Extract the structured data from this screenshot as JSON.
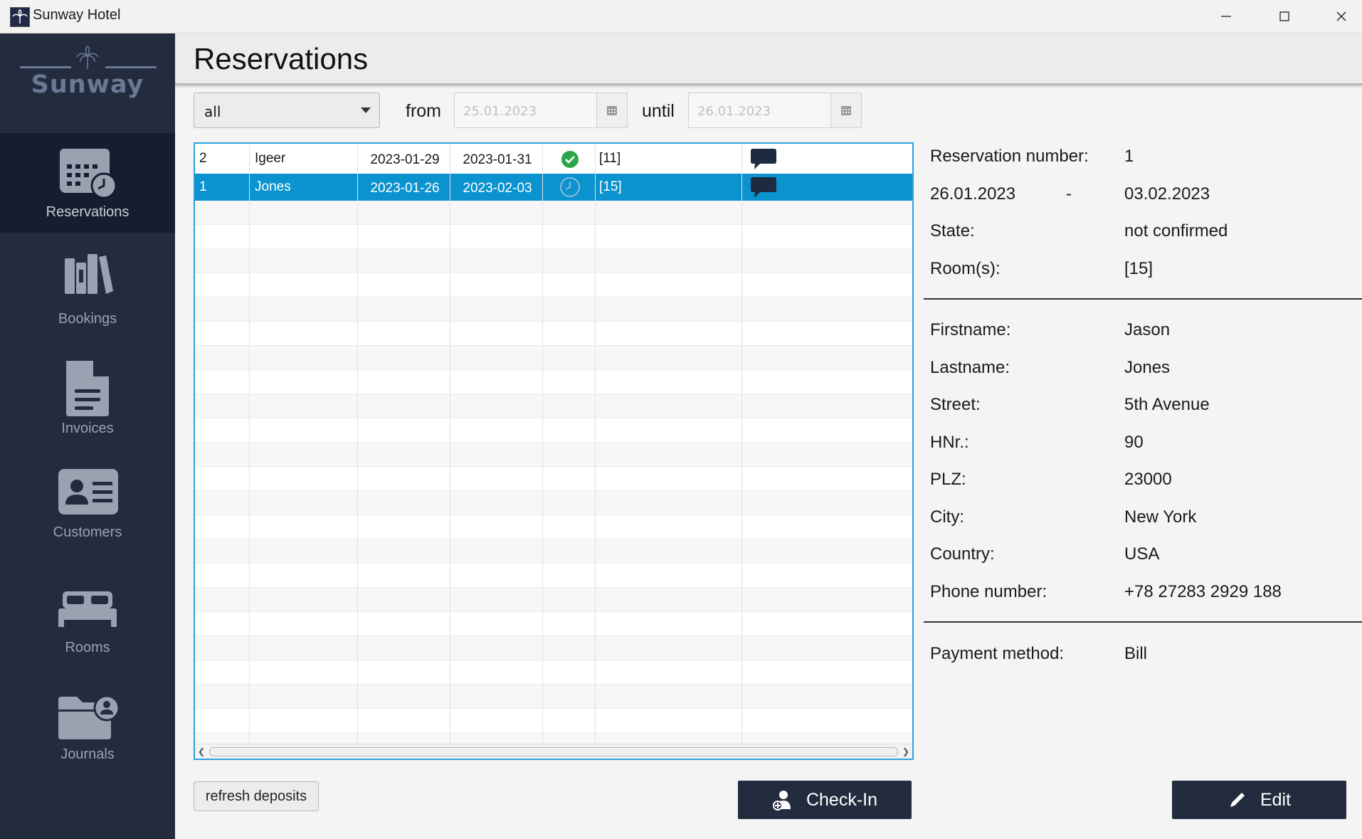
{
  "window": {
    "title": "Sunway Hotel"
  },
  "brand": {
    "name": "Sunway"
  },
  "sidebar": {
    "items": [
      {
        "label": "Reservations",
        "icon": "calendar-clock-icon",
        "active": true
      },
      {
        "label": "Bookings",
        "icon": "books-icon",
        "active": false
      },
      {
        "label": "Invoices",
        "icon": "document-icon",
        "active": false
      },
      {
        "label": "Customers",
        "icon": "id-card-icon",
        "active": false
      },
      {
        "label": "Rooms",
        "icon": "bed-icon",
        "active": false
      },
      {
        "label": "Journals",
        "icon": "folder-user-icon",
        "active": false
      }
    ]
  },
  "header": {
    "title": "Reservations"
  },
  "filter": {
    "select_value": "all",
    "from_label": "from",
    "from_value": "25.01.2023",
    "until_label": "until",
    "until_value": "26.01.2023"
  },
  "table": {
    "rows": [
      {
        "id": "2",
        "name": "Igeer",
        "start": "2023-01-29",
        "end": "2023-01-31",
        "status": "confirmed",
        "status_icon": "check-circle-icon",
        "rooms": "[11]",
        "note_icon": "comment-icon",
        "selected": false
      },
      {
        "id": "1",
        "name": "Jones",
        "start": "2023-01-26",
        "end": "2023-02-03",
        "status": "pending",
        "status_icon": "clock-icon",
        "rooms": "[15]",
        "note_icon": "comment-icon",
        "selected": true
      }
    ]
  },
  "details": {
    "reservation_number_label": "Reservation number:",
    "reservation_number": "1",
    "date_from": "26.01.2023",
    "date_sep": "-",
    "date_to": "03.02.2023",
    "state_label": "State:",
    "state": "not confirmed",
    "rooms_label": "Room(s):",
    "rooms": "[15]",
    "firstname_label": "Firstname:",
    "firstname": "Jason",
    "lastname_label": "Lastname:",
    "lastname": "Jones",
    "street_label": "Street:",
    "street": "5th Avenue",
    "hnr_label": "HNr.:",
    "hnr": "90",
    "plz_label": "PLZ:",
    "plz": "23000",
    "city_label": "City:",
    "city": "New York",
    "country_label": "Country:",
    "country": "USA",
    "phone_label": "Phone number:",
    "phone": "+78 27283 2929 188",
    "payment_label": "Payment method:",
    "payment": "Bill"
  },
  "buttons": {
    "refresh": "refresh deposits",
    "checkin": "Check-In",
    "edit": "Edit"
  },
  "colors": {
    "sidebar": "#232b3f",
    "sidebar_active": "#161d2e",
    "selection": "#0a93cf",
    "table_border": "#2aa3e0",
    "confirmed": "#2aa64a"
  }
}
